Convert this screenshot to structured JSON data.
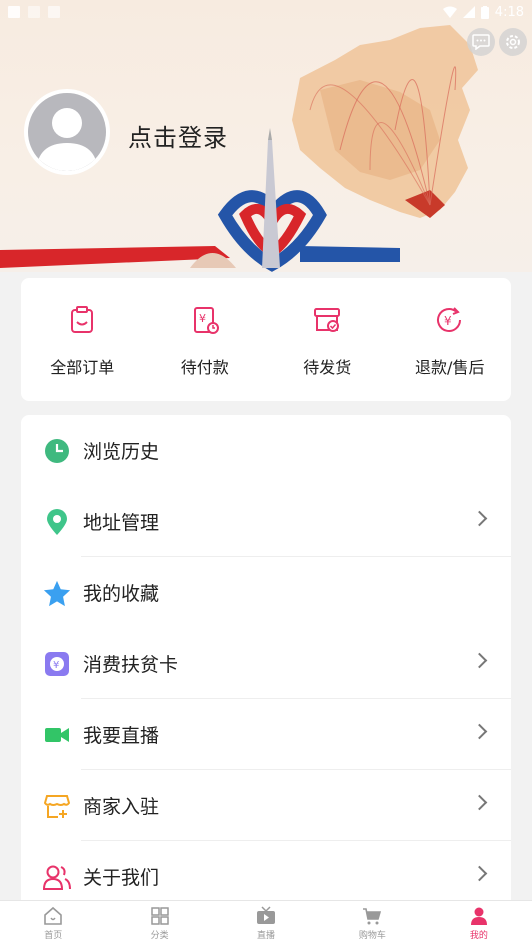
{
  "status_bar": {
    "time": "4:18"
  },
  "header": {
    "login_label": "点击登录"
  },
  "orders": [
    {
      "label": "全部订单",
      "icon": "clipboard-icon"
    },
    {
      "label": "待付款",
      "icon": "payment-pending-icon"
    },
    {
      "label": "待发货",
      "icon": "shipping-box-icon"
    },
    {
      "label": "退款/售后",
      "icon": "refund-icon"
    }
  ],
  "menu": [
    {
      "label": "浏览历史",
      "icon": "clock-icon",
      "icon_color": "#3fb97f",
      "arrow": false
    },
    {
      "label": "地址管理",
      "icon": "location-pin-icon",
      "icon_color": "#3fc58a",
      "arrow": true
    },
    {
      "label": "我的收藏",
      "icon": "star-icon",
      "icon_color": "#3aa0f0",
      "arrow": false
    },
    {
      "label": "消费扶贫卡",
      "icon": "card-icon",
      "icon_color": "#8a7af0",
      "arrow": true
    },
    {
      "label": "我要直播",
      "icon": "video-camera-icon",
      "icon_color": "#32c567",
      "arrow": true
    },
    {
      "label": "商家入驻",
      "icon": "store-icon",
      "icon_color": "#f5a623",
      "arrow": true
    },
    {
      "label": "关于我们",
      "icon": "people-icon",
      "icon_color": "#e8336a",
      "arrow": true
    }
  ],
  "tabs": [
    {
      "label": "首页",
      "icon": "home-icon",
      "active": false
    },
    {
      "label": "分类",
      "icon": "grid-icon",
      "active": false
    },
    {
      "label": "直播",
      "icon": "tv-icon",
      "active": false
    },
    {
      "label": "购物车",
      "icon": "cart-icon",
      "active": false
    },
    {
      "label": "我的",
      "icon": "user-icon",
      "active": true
    }
  ],
  "colors": {
    "accent": "#e8336a",
    "muted": "#999999"
  }
}
